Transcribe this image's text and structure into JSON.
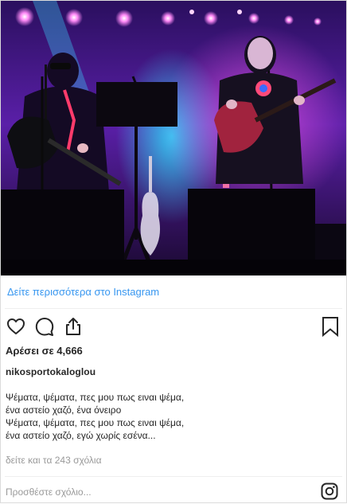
{
  "post": {
    "view_more_label": "Δείτε περισσότερα στο Instagram",
    "likes_text": "Αρέσει σε 4,666",
    "username": "nikosportokaloglou",
    "caption_lines": [
      "Ψέματα, ψέματα, πες μου πως ειναι ψέμα,",
      "ένα αστείο χαζό, ένα όνειρο",
      "Ψέματα, ψέματα, πες μου πως ειναι ψέμα,",
      "ένα αστείο χαζό, εγώ χωρίς εσένα..."
    ],
    "comments_link": "δείτε και τα 243 σχόλια",
    "add_comment_placeholder": "Προσθέστε σχόλιο..."
  },
  "icons": {
    "like": "heart-icon",
    "comment": "comment-icon",
    "share": "share-icon",
    "save": "bookmark-icon",
    "brand": "instagram-logo-icon"
  },
  "colors": {
    "link": "#3897f0",
    "muted": "#999999",
    "text": "#262626",
    "border": "#dbdbdb"
  }
}
